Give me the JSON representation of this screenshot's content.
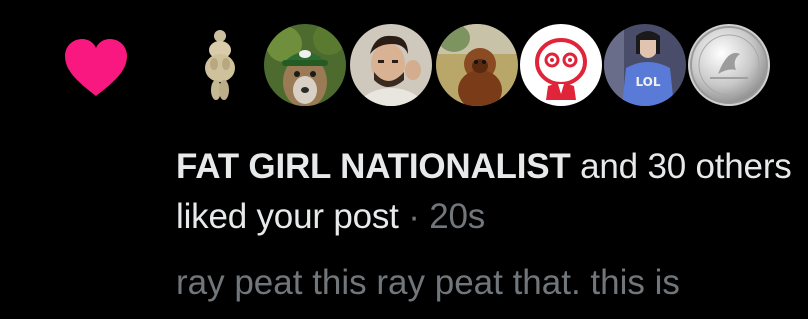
{
  "notification": {
    "type_icon": "heart-icon",
    "accent_color": "#f91880",
    "actor_name": "FAT GIRL NATIONALIST",
    "action_text": " and 30 others liked your post",
    "separator": " · ",
    "time_ago": "20s",
    "post_preview": "ray peat this ray peat that. this is",
    "avatars": [
      "venus-figurine-avatar",
      "deer-in-cap-avatar",
      "man-portrait-avatar",
      "bigfoot-avatar",
      "cartoon-face-avatar",
      "lol-shirt-avatar",
      "silver-coin-avatar"
    ]
  }
}
